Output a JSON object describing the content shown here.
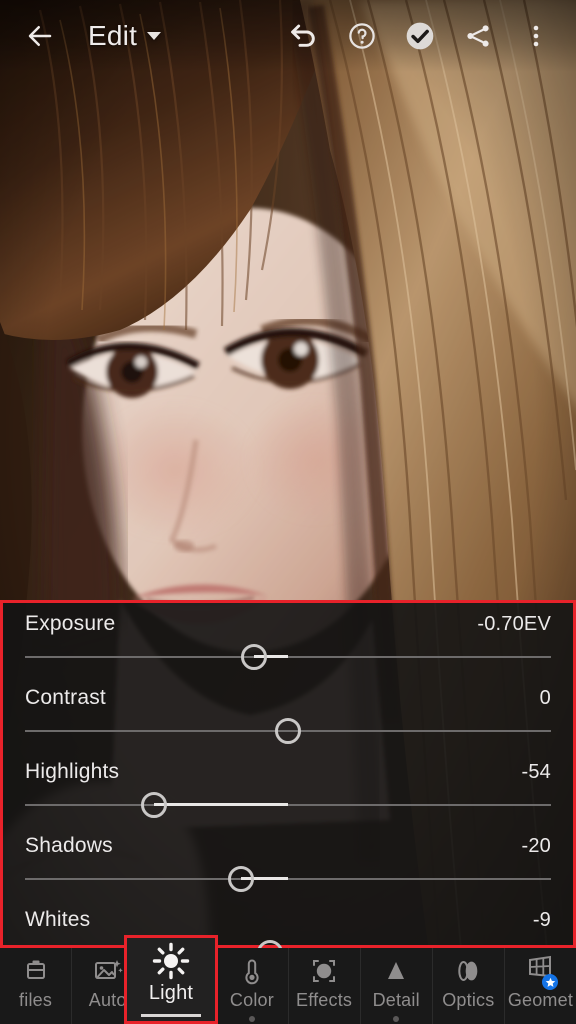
{
  "app": {
    "screen_title": "Edit"
  },
  "topbar": {
    "back_icon": "arrow-left-icon",
    "title": "Edit",
    "title_caret_icon": "chevron-down-icon",
    "undo_icon": "undo-icon",
    "help_icon": "help-circle-icon",
    "done_icon": "check-circle-icon",
    "share_icon": "share-icon",
    "overflow_icon": "more-vertical-icon"
  },
  "panel": {
    "highlight_color": "#e8222a",
    "sliders": [
      {
        "name": "Exposure",
        "value": "-0.70EV",
        "knob_pct": 43.5,
        "fill_from_pct": 43.5,
        "fill_to_pct": 50.0
      },
      {
        "name": "Contrast",
        "value": "0",
        "knob_pct": 50.0,
        "fill_from_pct": 50.0,
        "fill_to_pct": 50.0
      },
      {
        "name": "Highlights",
        "value": "-54",
        "knob_pct": 24.5,
        "fill_from_pct": 24.5,
        "fill_to_pct": 50.0
      },
      {
        "name": "Shadows",
        "value": "-20",
        "knob_pct": 41.0,
        "fill_from_pct": 41.0,
        "fill_to_pct": 50.0
      },
      {
        "name": "Whites",
        "value": "-9",
        "knob_pct": 46.5,
        "fill_from_pct": 46.5,
        "fill_to_pct": 50.0
      }
    ]
  },
  "bottombar": {
    "active_tab": "Light",
    "items": [
      {
        "label": "files",
        "icon": "profiles-icon",
        "active": false,
        "has_dot": false,
        "badge": false
      },
      {
        "label": "Auto",
        "icon": "auto-magic-icon",
        "active": false,
        "has_dot": false,
        "badge": false
      },
      {
        "label": "Light",
        "icon": "sun-icon",
        "active": true,
        "has_dot": false,
        "badge": false
      },
      {
        "label": "Color",
        "icon": "thermometer-icon",
        "active": false,
        "has_dot": true,
        "badge": false
      },
      {
        "label": "Effects",
        "icon": "effects-icon",
        "active": false,
        "has_dot": false,
        "badge": false
      },
      {
        "label": "Detail",
        "icon": "triangle-icon",
        "active": false,
        "has_dot": true,
        "badge": false
      },
      {
        "label": "Optics",
        "icon": "lens-icon",
        "active": false,
        "has_dot": false,
        "badge": false
      },
      {
        "label": "Geomet",
        "icon": "geometry-icon",
        "active": false,
        "has_dot": false,
        "badge": true
      }
    ]
  },
  "photo": {
    "description": "Close-up portrait of a young woman with long light-brown hair and bangs, warm brown background",
    "colors": {
      "background_dark": "#241812",
      "background_warm": "#4a3326",
      "hair_dark": "#2a1a12",
      "hair_light": "#c9a273",
      "skin": "#f2ddd3",
      "skin_shadow": "#d3aa9c",
      "lips": "#d08e8a",
      "eye": "#4a2a1c"
    }
  }
}
